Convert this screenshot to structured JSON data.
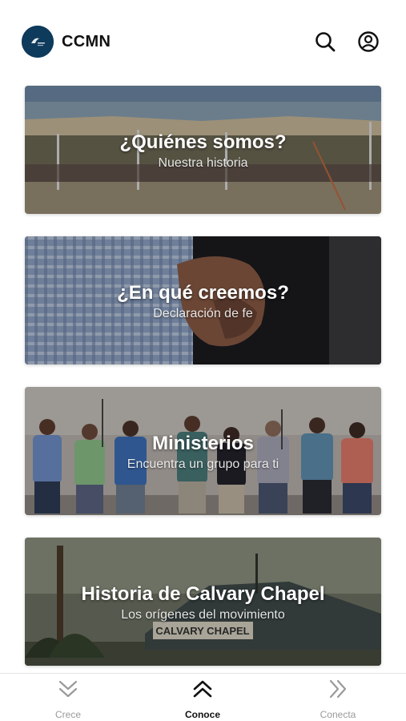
{
  "header": {
    "title": "CCMN",
    "logo_icon": "church-logo",
    "search_icon": "search-icon",
    "profile_icon": "user-circle-icon"
  },
  "cards": [
    {
      "title": "¿Quiénes somos?",
      "subtitle": "Nuestra historia",
      "image": "outdoor-tent-gathering-photo"
    },
    {
      "title": "¿En qué creemos?",
      "subtitle": "Declaración de fe",
      "image": "hand-holding-bible-photo"
    },
    {
      "title": "Ministerios",
      "subtitle": "Encuentra un grupo para ti",
      "image": "men-praying-group-photo"
    },
    {
      "title": "Historia de Calvary Chapel",
      "subtitle": "Los orígenes del movimiento",
      "image": "calvary-chapel-tent-vintage-photo"
    }
  ],
  "bottom_nav": {
    "items": [
      {
        "label": "Crece",
        "icon": "chevrons-down-icon",
        "active": false
      },
      {
        "label": "Conoce",
        "icon": "chevrons-up-icon",
        "active": true
      },
      {
        "label": "Conecta",
        "icon": "chevrons-right-icon",
        "active": false
      }
    ]
  },
  "colors": {
    "logo_bg": "#0e3a5c",
    "active_nav": "#111111",
    "inactive_nav": "#9a9a9a"
  }
}
